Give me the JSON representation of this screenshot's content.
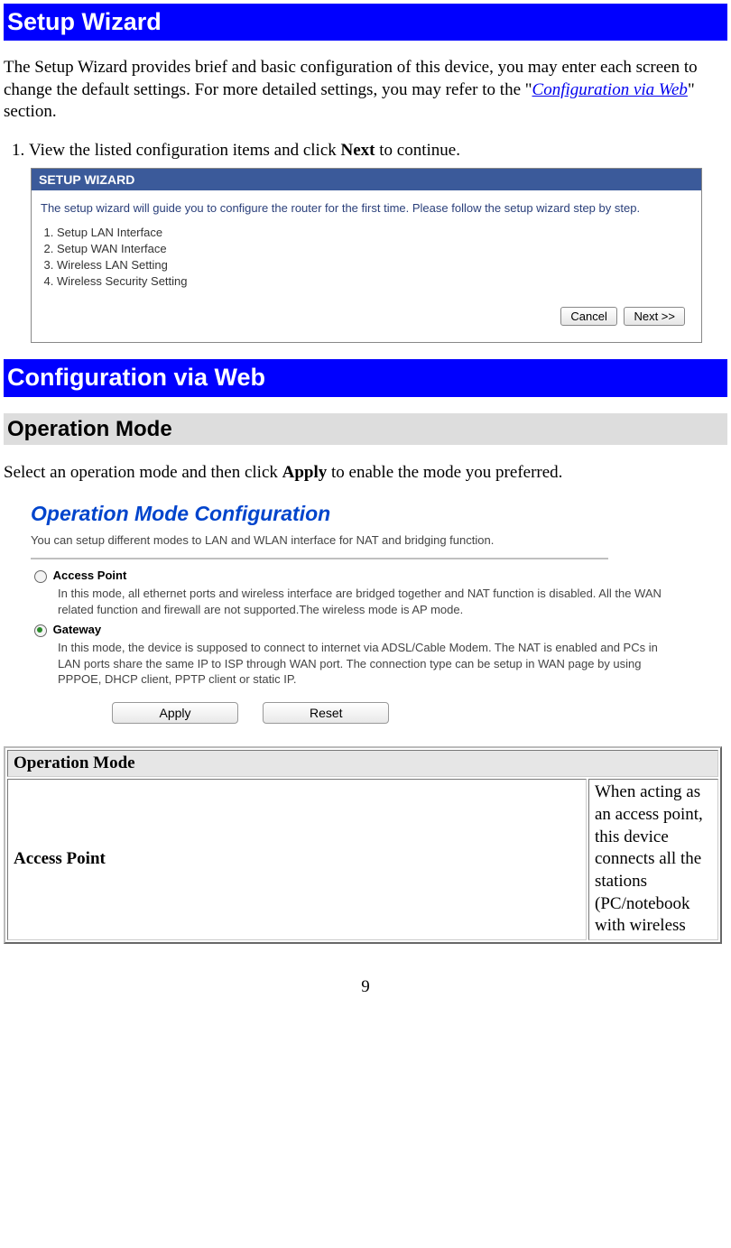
{
  "heading_setup": "Setup Wizard",
  "intro": {
    "prefix": "The Setup Wizard provides brief and basic configuration of this device, you may enter each screen to change the default settings. For more detailed settings, you may refer to the \"",
    "link": "Configuration via Web",
    "suffix": "\" section."
  },
  "step1": {
    "prefix": "View the listed configuration items and click ",
    "bold": "Next",
    "suffix": " to continue."
  },
  "fig1": {
    "header": "SETUP WIZARD",
    "intro": "The setup wizard will guide you to configure the router for the first time. Please follow the setup wizard step by step.",
    "items": [
      "Setup LAN Interface",
      "Setup WAN Interface",
      "Wireless LAN Setting",
      "Wireless Security Setting"
    ],
    "btn_cancel": "Cancel",
    "btn_next": "Next >>"
  },
  "heading_config": "Configuration via Web",
  "heading_opmode": "Operation Mode",
  "opmode_intro": {
    "prefix": "Select an operation mode and then click ",
    "bold": "Apply",
    "suffix": "  to enable the mode you preferred."
  },
  "fig2": {
    "title": "Operation Mode Configuration",
    "sub": "You can setup different modes to LAN and WLAN interface for NAT and bridging function.",
    "opt1": {
      "label": "Access Point",
      "checked": false,
      "desc": "In this mode, all ethernet ports and wireless interface are bridged together and NAT function is disabled. All the WAN related function and firewall are not supported.The wireless mode is AP mode."
    },
    "opt2": {
      "label": "Gateway",
      "checked": true,
      "desc": "In this mode, the device is supposed to connect to internet via ADSL/Cable Modem. The NAT is enabled and PCs in LAN ports share the same IP to ISP through WAN port. The connection type can be setup in WAN page by using PPPOE, DHCP client, PPTP client or static IP."
    },
    "btn_apply": "Apply",
    "btn_reset": "Reset"
  },
  "table": {
    "header": "Operation Mode",
    "row1_left": "Access Point",
    "row1_right": " When acting as an access point, this device connects all the stations (PC/notebook with wireless"
  },
  "page_number": "9"
}
